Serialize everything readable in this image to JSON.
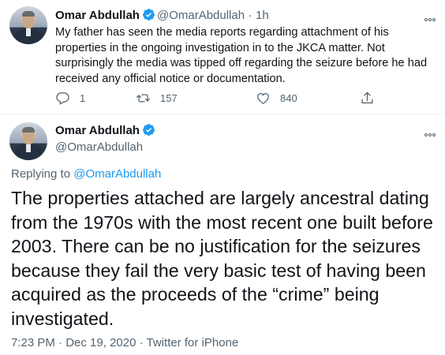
{
  "tweet1": {
    "author_name": "Omar Abdullah",
    "handle": "@OmarAbdullah",
    "separator": "·",
    "time": "1h",
    "text": "My father has seen the media reports regarding attachment of his properties in the ongoing investigation in to the JKCA matter. Not surprisingly the media was tipped off regarding the seizure before he had received any official notice or documentation.",
    "replies": "1",
    "retweets": "157",
    "likes": "840"
  },
  "tweet2": {
    "author_name": "Omar Abdullah",
    "handle": "@OmarAbdullah",
    "replying_to_label": "Replying to",
    "replying_to_handle": "@OmarAbdullah",
    "text": "The properties attached are largely ancestral dating from the 1970s with  the most recent one built before 2003. There can be no justification for the seizures because they fail the very basic test of having been acquired as the proceeds of the “crime” being investigated.",
    "time": "7:23 PM",
    "date": "Dec 19, 2020",
    "source": "Twitter for iPhone",
    "dot": "·"
  },
  "colors": {
    "accent": "#1d9bf0",
    "secondary_text": "#536471",
    "primary_text": "#0f1419"
  },
  "icons": [
    "verified-badge-icon",
    "more-icon",
    "reply-icon",
    "retweet-icon",
    "like-icon",
    "share-icon"
  ]
}
